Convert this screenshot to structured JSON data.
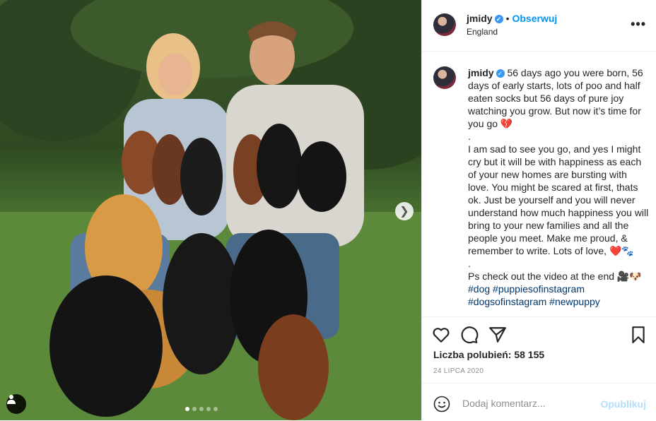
{
  "header": {
    "username": "jmidy",
    "separator": "•",
    "follow_label": "Obserwuj",
    "location": "England",
    "more_label": "•••"
  },
  "caption": {
    "username": "jmidy",
    "lines": [
      "56 days ago you were born, 56 days of early starts, lots of poo and half eaten socks but 56 days of pure joy watching you grow. But now it’s time for you go 💔",
      ".",
      "I am sad to see you go, and yes I might cry but it will be with happiness as each of your new homes are bursting with love. You might be scared at first, thats ok. Just be yourself and you will never understand how much happiness you will bring to your new families and all the people you meet. Make me proud, & remember to write. Lots of love, ❤️🐾",
      ".",
      "Ps check out the video at the end 🎥🐶"
    ],
    "hashtags_line1": "#dog #puppiesofinstagram",
    "hashtags_line2": "#dogsofinstagram #newpuppy"
  },
  "likes": "Liczba polubień: 58 155",
  "date": "24 LIPCA 2020",
  "comment": {
    "placeholder": "Dodaj komentarz...",
    "post_label": "Opublikuj"
  },
  "photo": {
    "next_icon": "chevron-right-icon",
    "dots_count": 5,
    "active_dot": 1
  },
  "colors": {
    "accent": "#0095f6",
    "post_disabled": "#b2dffc",
    "text": "#262626",
    "muted": "#8e8e8e"
  }
}
